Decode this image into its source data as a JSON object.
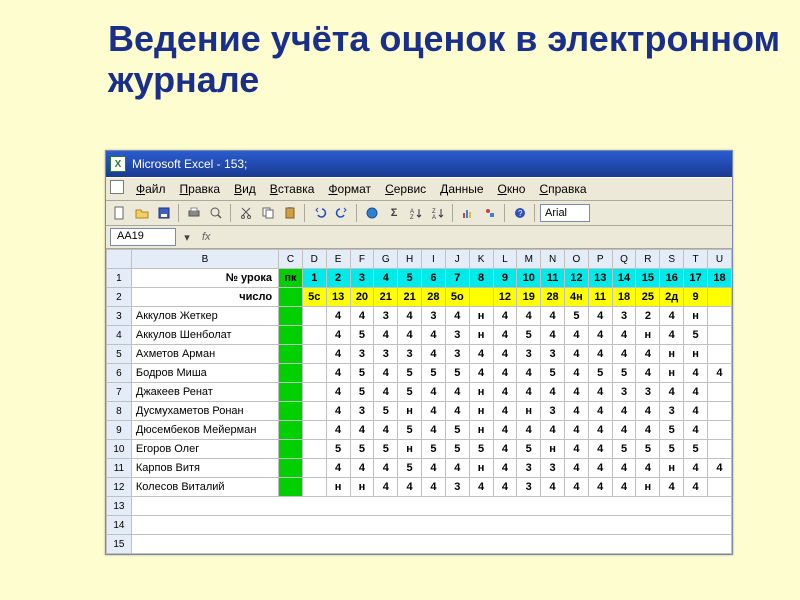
{
  "slide": {
    "title": "Ведение учёта оценок в электронном журнале"
  },
  "window": {
    "title": "Microsoft Excel - 153;",
    "font": "Arial"
  },
  "menu": [
    "Файл",
    "Правка",
    "Вид",
    "Вставка",
    "Формат",
    "Сервис",
    "Данные",
    "Окно",
    "Справка"
  ],
  "namebox": "AA19",
  "fx_label": "fx",
  "columns": [
    "B",
    "C",
    "D",
    "E",
    "F",
    "G",
    "H",
    "I",
    "J",
    "K",
    "L",
    "M",
    "N",
    "O",
    "P",
    "Q",
    "R",
    "S",
    "T",
    "U"
  ],
  "row_numbers": [
    "1",
    "2",
    "3",
    "4",
    "5",
    "6",
    "7",
    "8",
    "9",
    "10",
    "11",
    "12",
    "13",
    "14",
    "15"
  ],
  "header_rows": {
    "lesson_label": "№ урока",
    "lesson_pk": "пк",
    "lesson_nums": [
      "1",
      "2",
      "3",
      "4",
      "5",
      "6",
      "7",
      "8",
      "9",
      "10",
      "11",
      "12",
      "13",
      "14",
      "15",
      "16",
      "17",
      "18"
    ],
    "date_label": "число",
    "dates": [
      "5с",
      "13",
      "20",
      "21",
      "21",
      "28",
      "5о",
      "",
      "12",
      "19",
      "28",
      "4н",
      "11",
      "18",
      "25",
      "2д",
      "9",
      ""
    ]
  },
  "students": [
    {
      "name": "Аккулов Жеткер",
      "g": [
        "",
        "4",
        "4",
        "3",
        "4",
        "3",
        "4",
        "н",
        "4",
        "4",
        "4",
        "5",
        "4",
        "3",
        "2",
        "4",
        "н",
        ""
      ]
    },
    {
      "name": "Аккулов Шенболат",
      "g": [
        "",
        "4",
        "5",
        "4",
        "4",
        "4",
        "3",
        "н",
        "4",
        "5",
        "4",
        "4",
        "4",
        "4",
        "н",
        "4",
        "5",
        ""
      ]
    },
    {
      "name": "Ахметов Арман",
      "g": [
        "",
        "4",
        "3",
        "3",
        "3",
        "4",
        "3",
        "4",
        "4",
        "3",
        "3",
        "4",
        "4",
        "4",
        "4",
        "н",
        "н",
        ""
      ]
    },
    {
      "name": "Бодров Миша",
      "g": [
        "",
        "4",
        "5",
        "4",
        "5",
        "5",
        "5",
        "4",
        "4",
        "4",
        "5",
        "4",
        "5",
        "5",
        "4",
        "н",
        "4",
        "4"
      ]
    },
    {
      "name": "Джакеев Ренат",
      "g": [
        "",
        "4",
        "5",
        "4",
        "5",
        "4",
        "4",
        "н",
        "4",
        "4",
        "4",
        "4",
        "4",
        "3",
        "3",
        "4",
        "4",
        ""
      ]
    },
    {
      "name": "Дусмухаметов Ронан",
      "g": [
        "",
        "4",
        "3",
        "5",
        "н",
        "4",
        "4",
        "н",
        "4",
        "н",
        "3",
        "4",
        "4",
        "4",
        "4",
        "3",
        "4",
        ""
      ]
    },
    {
      "name": "Дюсембеков Мейерман",
      "g": [
        "",
        "4",
        "4",
        "4",
        "5",
        "4",
        "5",
        "н",
        "4",
        "4",
        "4",
        "4",
        "4",
        "4",
        "4",
        "5",
        "4",
        ""
      ]
    },
    {
      "name": "Егоров Олег",
      "g": [
        "",
        "5",
        "5",
        "5",
        "н",
        "5",
        "5",
        "5",
        "4",
        "5",
        "н",
        "4",
        "4",
        "5",
        "5",
        "5",
        "5",
        ""
      ]
    },
    {
      "name": "Карпов Витя",
      "g": [
        "",
        "4",
        "4",
        "4",
        "5",
        "4",
        "4",
        "н",
        "4",
        "3",
        "3",
        "4",
        "4",
        "4",
        "4",
        "н",
        "4",
        "4"
      ]
    },
    {
      "name": "Колесов Виталий",
      "g": [
        "",
        "н",
        "н",
        "4",
        "4",
        "4",
        "3",
        "4",
        "4",
        "3",
        "4",
        "4",
        "4",
        "4",
        "н",
        "4",
        "4",
        ""
      ]
    }
  ]
}
